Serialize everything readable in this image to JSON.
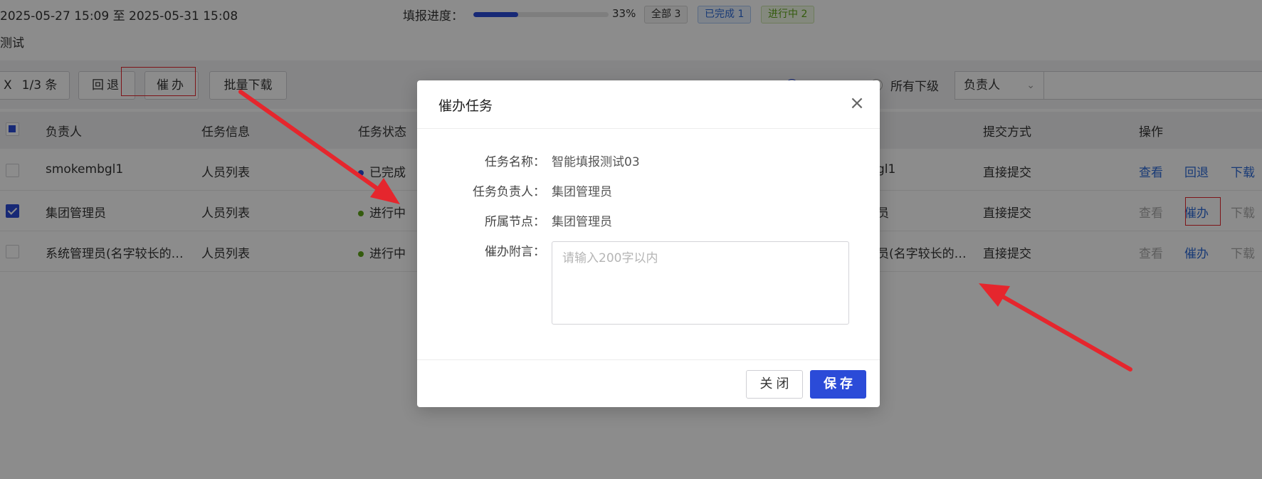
{
  "header": {
    "date_range": "2025-05-27 15:09 至 2025-05-31 15:08",
    "progress_label": "填报进度：",
    "progress_value": 0.33,
    "progress_text": "33%",
    "tags": {
      "all": "全部 3",
      "done": "已完成 1",
      "in_progress": "进行中 2"
    },
    "task_title": "测试"
  },
  "toolbar": {
    "selection_close": "X",
    "selection_count": "1/3 条",
    "rollback_label": "回退",
    "urge_label": "催办",
    "batch_download_label": "批量下载",
    "radio_all_subordinates": "所有下级",
    "filter_select_value": "负责人"
  },
  "table": {
    "columns": [
      "负责人",
      "任务信息",
      "任务状态",
      "提交方式",
      "操作"
    ],
    "rows": [
      {
        "owner": "smokembgl1",
        "info": "人员列表",
        "status": "已完成",
        "node_suffix": "gl1",
        "submit": "直接提交",
        "actions": [
          "查看",
          "回退",
          "下载"
        ]
      },
      {
        "owner": "集团管理员",
        "info": "人员列表",
        "status": "进行中",
        "node_suffix": "员",
        "submit": "直接提交",
        "actions": [
          "查看",
          "催办",
          "下载"
        ]
      },
      {
        "owner": "系统管理员(名字较长的…",
        "info": "人员列表",
        "status": "进行中",
        "node_suffix": "员(名字较长的…",
        "submit": "直接提交",
        "actions": [
          "查看",
          "催办",
          "下载"
        ]
      }
    ]
  },
  "modal": {
    "title": "催办任务",
    "fields": {
      "task_name_label": "任务名称：",
      "task_name_value": "智能填报测试03",
      "owner_label": "任务负责人：",
      "owner_value": "集团管理员",
      "node_label": "所属节点：",
      "node_value": "集团管理员",
      "message_label": "催办附言：",
      "message_placeholder": "请输入200字以内"
    },
    "close_label": "关闭",
    "save_label": "保存"
  },
  "colors": {
    "primary": "#2b4bd8",
    "link": "#2d6ad8",
    "success": "#5fa619",
    "annotation": "#e5262d"
  }
}
